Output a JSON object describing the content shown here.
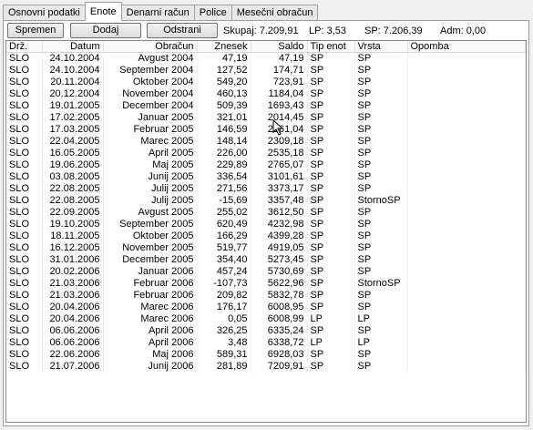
{
  "tabs": [
    {
      "label": "Osnovni podatki",
      "active": false
    },
    {
      "label": "Enote",
      "active": true
    },
    {
      "label": "Denarni račun",
      "active": false
    },
    {
      "label": "Police",
      "active": false
    },
    {
      "label": "Mesečni obračun",
      "active": false
    }
  ],
  "toolbar": {
    "save_label": "Spremen",
    "add_label": "Dodaj",
    "remove_label": "Odstrani",
    "sum_text": "Skupaj: 7.209,91",
    "lp_text": "LP: 3,53",
    "sp_text": "SP: 7.206,39",
    "adm_text": "Adm: 0,00"
  },
  "columns": [
    "Drž.",
    "Datum",
    "Obračun",
    "Znesek",
    "Saldo",
    "Tip enot",
    "Vrsta",
    "Opomba"
  ],
  "rows": [
    [
      "SLO",
      "24.10.2004",
      "Avgust 2004",
      "47,19",
      "47,19",
      "SP",
      "SP",
      ""
    ],
    [
      "SLO",
      "24.10.2004",
      "September 2004",
      "127,52",
      "174,71",
      "SP",
      "SP",
      ""
    ],
    [
      "SLO",
      "20.11.2004",
      "Oktober 2004",
      "549,20",
      "723,91",
      "SP",
      "SP",
      ""
    ],
    [
      "SLO",
      "20.12.2004",
      "November 2004",
      "460,13",
      "1184,04",
      "SP",
      "SP",
      ""
    ],
    [
      "SLO",
      "19.01.2005",
      "December 2004",
      "509,39",
      "1693,43",
      "SP",
      "SP",
      ""
    ],
    [
      "SLO",
      "17.02.2005",
      "Januar 2005",
      "321,01",
      "2014,45",
      "SP",
      "SP",
      ""
    ],
    [
      "SLO",
      "17.03.2005",
      "Februar 2005",
      "146,59",
      "2161,04",
      "SP",
      "SP",
      ""
    ],
    [
      "SLO",
      "22.04.2005",
      "Marec 2005",
      "148,14",
      "2309,18",
      "SP",
      "SP",
      ""
    ],
    [
      "SLO",
      "16.05.2005",
      "April 2005",
      "226,00",
      "2535,18",
      "SP",
      "SP",
      ""
    ],
    [
      "SLO",
      "19.06.2005",
      "Maj 2005",
      "229,89",
      "2765,07",
      "SP",
      "SP",
      ""
    ],
    [
      "SLO",
      "03.08.2005",
      "Junij 2005",
      "336,54",
      "3101,61",
      "SP",
      "SP",
      ""
    ],
    [
      "SLO",
      "22.08.2005",
      "Julij 2005",
      "271,56",
      "3373,17",
      "SP",
      "SP",
      ""
    ],
    [
      "SLO",
      "22.08.2005",
      "Julij 2005",
      "-15,69",
      "3357,48",
      "SP",
      "StornoSP",
      ""
    ],
    [
      "SLO",
      "22.09.2005",
      "Avgust 2005",
      "255,02",
      "3612,50",
      "SP",
      "SP",
      ""
    ],
    [
      "SLO",
      "19.10.2005",
      "September 2005",
      "620,49",
      "4232,98",
      "SP",
      "SP",
      ""
    ],
    [
      "SLO",
      "18.11.2005",
      "Oktober 2005",
      "166,29",
      "4399,28",
      "SP",
      "SP",
      ""
    ],
    [
      "SLO",
      "16.12.2005",
      "November 2005",
      "519,77",
      "4919,05",
      "SP",
      "SP",
      ""
    ],
    [
      "SLO",
      "31.01.2006",
      "December 2005",
      "354,40",
      "5273,45",
      "SP",
      "SP",
      ""
    ],
    [
      "SLO",
      "20.02.2006",
      "Januar 2006",
      "457,24",
      "5730,69",
      "SP",
      "SP",
      ""
    ],
    [
      "SLO",
      "21.03.2006",
      "Februar 2006",
      "-107,73",
      "5622,96",
      "SP",
      "StornoSP",
      ""
    ],
    [
      "SLO",
      "21.03.2006",
      "Februar 2006",
      "209,82",
      "5832,78",
      "SP",
      "SP",
      ""
    ],
    [
      "SLO",
      "20.04.2006",
      "Marec 2006",
      "176,17",
      "6008,95",
      "SP",
      "SP",
      ""
    ],
    [
      "SLO",
      "20.04.2006",
      "Marec 2006",
      "0,05",
      "6008,99",
      "LP",
      "LP",
      ""
    ],
    [
      "SLO",
      "06.06.2006",
      "April 2006",
      "326,25",
      "6335,24",
      "SP",
      "SP",
      ""
    ],
    [
      "SLO",
      "06.06.2006",
      "April 2006",
      "3,48",
      "6338,72",
      "LP",
      "LP",
      ""
    ],
    [
      "SLO",
      "22.06.2006",
      "Maj 2006",
      "589,31",
      "6928,03",
      "SP",
      "SP",
      ""
    ],
    [
      "SLO",
      "21.07.2006",
      "Junij 2006",
      "281,89",
      "7209,91",
      "SP",
      "SP",
      ""
    ]
  ]
}
